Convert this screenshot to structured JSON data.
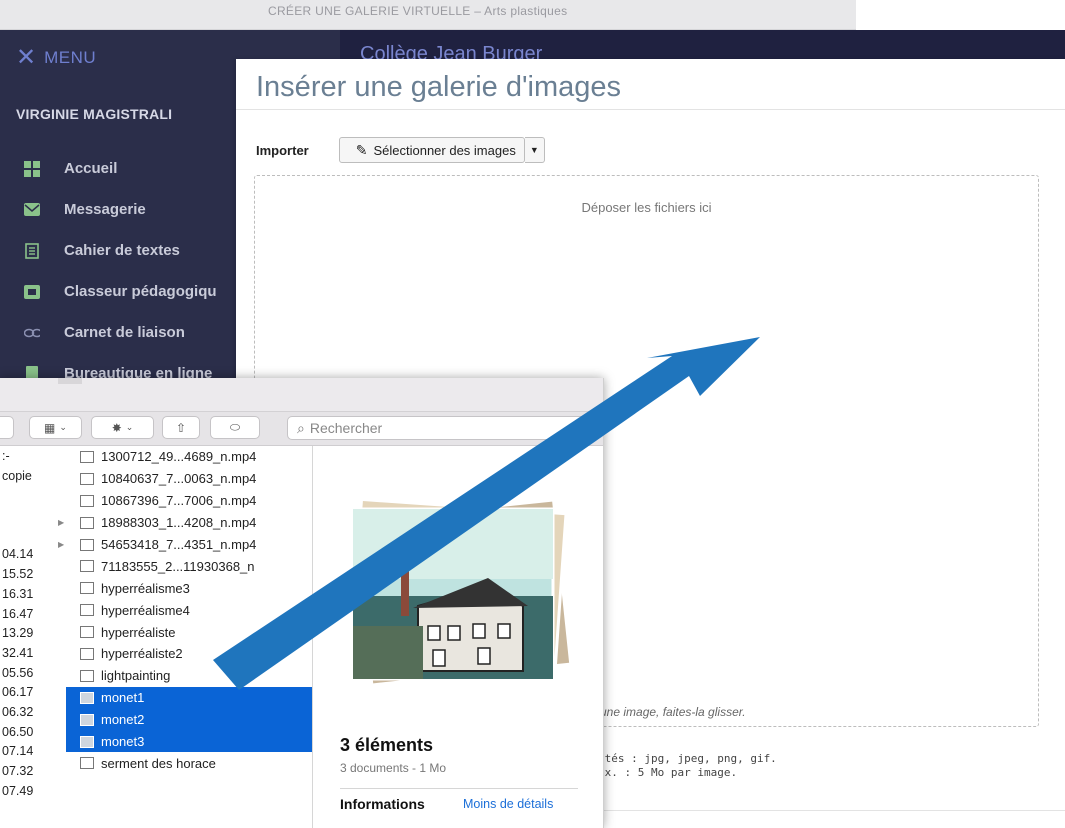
{
  "browser": {
    "tab_title": "CRÉER UNE GALERIE VIRTUELLE – Arts plastiques"
  },
  "sidebar": {
    "menu_label": "MENU",
    "user_name": "VIRGINIE MAGISTRALI",
    "items": [
      {
        "label": "Accueil",
        "icon": "grid-icon"
      },
      {
        "label": "Messagerie",
        "icon": "envelope-icon"
      },
      {
        "label": "Cahier de textes",
        "icon": "notebook-icon"
      },
      {
        "label": "Classeur pédagogiqu",
        "icon": "binder-icon"
      },
      {
        "label": "Carnet de liaison",
        "icon": "link-icon"
      },
      {
        "label": "Bureautique en ligne",
        "icon": "document-icon"
      }
    ]
  },
  "header": {
    "school_name": "Collège Jean Burger"
  },
  "modal": {
    "title": "Insérer une galerie d'images",
    "import_label": "Importer",
    "select_button": "Sélectionner des images",
    "drop_text": "Déposer les fichiers ici",
    "drop_hint": "une image, faites-la glisser.",
    "accepted_formats": "ptés : jpg, jpeg, png, gif.",
    "max_size": "ax. : 5 Mo par image."
  },
  "finder": {
    "search_placeholder": "Rechercher",
    "left_column": [
      ":-",
      "copie",
      "",
      "",
      "",
      "04.14",
      "15.52",
      "16.31",
      "16.47",
      "13.29",
      "32.41",
      "05.56",
      "06.17",
      "06.32",
      "06.50",
      "07.14",
      "07.32",
      "07.49"
    ],
    "files": [
      {
        "name": "1300712_49...4689_n.mp4",
        "selected": false,
        "expandable": false
      },
      {
        "name": "10840637_7...0063_n.mp4",
        "selected": false,
        "expandable": false
      },
      {
        "name": "10867396_7...7006_n.mp4",
        "selected": false,
        "expandable": false
      },
      {
        "name": "18988303_1...4208_n.mp4",
        "selected": false,
        "expandable": true
      },
      {
        "name": "54653418_7...4351_n.mp4",
        "selected": false,
        "expandable": true
      },
      {
        "name": "71183555_2...11930368_n",
        "selected": false,
        "expandable": false
      },
      {
        "name": "hyperréalisme3",
        "selected": false,
        "expandable": false
      },
      {
        "name": "hyperréalisme4",
        "selected": false,
        "expandable": false
      },
      {
        "name": "hyperréaliste",
        "selected": false,
        "expandable": false
      },
      {
        "name": "hyperréaliste2",
        "selected": false,
        "expandable": false
      },
      {
        "name": "lightpainting",
        "selected": false,
        "expandable": false
      },
      {
        "name": "monet1",
        "selected": true,
        "expandable": false
      },
      {
        "name": "monet2",
        "selected": true,
        "expandable": false
      },
      {
        "name": "monet3",
        "selected": true,
        "expandable": false
      },
      {
        "name": "serment des horace",
        "selected": false,
        "expandable": false
      }
    ],
    "preview": {
      "title": "3 éléments",
      "subtitle": "3 documents - 1 Mo",
      "info_label": "Informations",
      "more_link": "Moins de détails"
    }
  },
  "colors": {
    "sidebar_bg": "#2b2e4a",
    "accent_blue": "#0a64d6",
    "arrow_blue": "#1f75bd"
  }
}
